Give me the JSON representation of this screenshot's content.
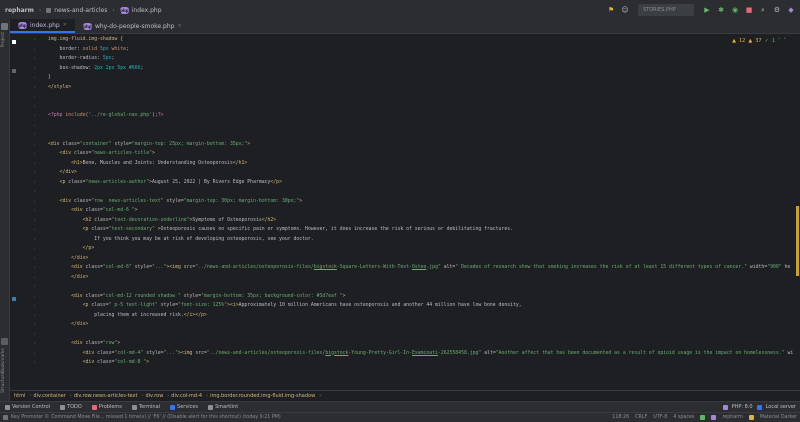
{
  "navbar": {
    "breadcrumbs": [
      "repharm",
      "news-and-articles",
      "index.php"
    ],
    "run_config": "STORIES.PHP",
    "icons": [
      "vcs-icon",
      "user-add-icon",
      "run-icon",
      "debug-icon",
      "coverage-icon",
      "stop-icon",
      "search-icon",
      "settings-icon",
      "ide-logo-icon"
    ]
  },
  "tabs": [
    {
      "label": "index.php",
      "active": true,
      "badge": "PHP"
    },
    {
      "label": "why-do-people-smoke.php",
      "active": false,
      "badge": "PHP"
    }
  ],
  "left_strip": {
    "top_label": "Project",
    "bottom_labels": [
      "Structure",
      "Bookmarks"
    ]
  },
  "editor_status": {
    "warnings": "12",
    "typos": "37",
    "ok": "1"
  },
  "code_lines": [
    {
      "n": "",
      "segs": [
        [
          "c-sel",
          "img.img-fluid.img-shadow "
        ],
        [
          "c-punc",
          "{"
        ]
      ]
    },
    {
      "n": "",
      "segs": [
        [
          "c-prop",
          "    border: "
        ],
        [
          "c-kw",
          "solid "
        ],
        [
          "c-num",
          "5px "
        ],
        [
          "c-kw",
          "white"
        ],
        [
          "c-punc",
          ";"
        ]
      ]
    },
    {
      "n": "",
      "segs": [
        [
          "c-prop",
          "    border-radius: "
        ],
        [
          "c-num",
          "5px"
        ],
        [
          "c-punc",
          ";"
        ]
      ]
    },
    {
      "n": "",
      "segs": [
        [
          "c-prop",
          "    box-shadow: "
        ],
        [
          "c-num",
          "2px 2px 5px #666"
        ],
        [
          "c-punc",
          ";"
        ]
      ]
    },
    {
      "n": "",
      "segs": [
        [
          "c-punc",
          "}"
        ]
      ]
    },
    {
      "n": "",
      "segs": [
        [
          "c-tag",
          "</style>"
        ]
      ]
    },
    {
      "n": "",
      "segs": []
    },
    {
      "n": "",
      "segs": []
    },
    {
      "n": "",
      "segs": [
        [
          "c-php",
          "<?php "
        ],
        [
          "c-kw",
          "include"
        ],
        [
          "c-punc",
          "("
        ],
        [
          "c-val",
          "'../re-global-nav.php'"
        ],
        [
          "c-punc",
          ");"
        ],
        [
          "c-php",
          "?>"
        ]
      ]
    },
    {
      "n": "",
      "segs": []
    },
    {
      "n": "",
      "segs": []
    },
    {
      "n": "",
      "segs": [
        [
          "c-tag",
          "<div "
        ],
        [
          "c-attr",
          "class="
        ],
        [
          "c-val",
          "\"container\" "
        ],
        [
          "c-attr",
          "style="
        ],
        [
          "c-val",
          "\"margin-top: 25px; margin-bottom: 35px;\""
        ],
        [
          "c-tag",
          ">"
        ]
      ]
    },
    {
      "n": "",
      "segs": [
        [
          "c-tag",
          "    <div "
        ],
        [
          "c-attr",
          "class="
        ],
        [
          "c-val",
          "\"news-articles-title\""
        ],
        [
          "c-tag",
          ">"
        ]
      ]
    },
    {
      "n": "",
      "segs": [
        [
          "c-tag",
          "        <h1>"
        ],
        [
          "c-text",
          "Bone, Muscles and Joints: Understanding Osteoporosis"
        ],
        [
          "c-tag",
          "</h1>"
        ]
      ]
    },
    {
      "n": "",
      "segs": [
        [
          "c-tag",
          "    </div>"
        ]
      ]
    },
    {
      "n": "",
      "segs": [
        [
          "c-tag",
          "    <p "
        ],
        [
          "c-attr",
          "class="
        ],
        [
          "c-val",
          "\"news-articles-author\""
        ],
        [
          "c-tag",
          ">"
        ],
        [
          "c-text",
          "August 25, 2022 | By Rivers Edge Pharmacy"
        ],
        [
          "c-tag",
          "</p>"
        ]
      ]
    },
    {
      "n": "",
      "segs": []
    },
    {
      "n": "",
      "segs": [
        [
          "c-tag",
          "    <div "
        ],
        [
          "c-attr",
          "class="
        ],
        [
          "c-val",
          "\"row  news-articles-text\" "
        ],
        [
          "c-attr",
          "style="
        ],
        [
          "c-val",
          "\"margin-top: 30px; margin-bottom: 30px;\""
        ],
        [
          "c-tag",
          ">"
        ]
      ]
    },
    {
      "n": "",
      "segs": [
        [
          "c-tag",
          "        <div "
        ],
        [
          "c-attr",
          "class="
        ],
        [
          "c-val",
          "\"col-md-6 \""
        ],
        [
          "c-tag",
          ">"
        ]
      ]
    },
    {
      "n": "",
      "segs": [
        [
          "c-tag",
          "            <h2 "
        ],
        [
          "c-attr",
          "class="
        ],
        [
          "c-val",
          "\"text-decoration-underline\""
        ],
        [
          "c-tag",
          ">"
        ],
        [
          "c-text",
          "Symptoms of Osteoporosis"
        ],
        [
          "c-tag",
          "</h2>"
        ]
      ]
    },
    {
      "n": "",
      "segs": [
        [
          "c-tag",
          "            <p "
        ],
        [
          "c-attr",
          "class="
        ],
        [
          "c-val",
          "\"text-secondary\" "
        ],
        [
          "c-tag",
          ">"
        ],
        [
          "c-text",
          "Osteoporosis causes no specific pain or symptoms. However, it does increase the risk of serious or debilitating fractures."
        ]
      ]
    },
    {
      "n": "",
      "segs": [
        [
          "c-text",
          "                If you think you may be at risk of developing osteoporosis, see your doctor."
        ]
      ]
    },
    {
      "n": "",
      "segs": [
        [
          "c-tag",
          "            </p>"
        ]
      ]
    },
    {
      "n": "",
      "segs": [
        [
          "c-tag",
          "        </div>"
        ]
      ]
    },
    {
      "n": "",
      "segs": [
        [
          "c-tag",
          "        <div "
        ],
        [
          "c-attr",
          "class="
        ],
        [
          "c-val",
          "\"col-md-6\" "
        ],
        [
          "c-attr",
          "style="
        ],
        [
          "c-val",
          "\"...\""
        ],
        [
          "c-tag",
          "><img "
        ],
        [
          "c-attr",
          "src="
        ],
        [
          "c-val",
          "\"../news-and-articles/osteoporosis-files/"
        ],
        [
          "c-link",
          "bigstock"
        ],
        [
          "c-val",
          "-Square-Letters-With-Text-"
        ],
        [
          "c-link",
          "Osteo"
        ],
        [
          "c-val",
          ".jpg\" "
        ],
        [
          "c-attr",
          "alt="
        ],
        [
          "c-val",
          "\" Decades of research show that smoking increases the risk of at least 15 different types of cancer.\" "
        ],
        [
          "c-attr",
          "width="
        ],
        [
          "c-val",
          "\"900\" "
        ],
        [
          "c-attr",
          "he"
        ]
      ]
    },
    {
      "n": "",
      "segs": [
        [
          "c-tag",
          "        </div>"
        ]
      ]
    },
    {
      "n": "",
      "segs": []
    },
    {
      "n": "",
      "segs": [
        [
          "c-tag",
          "        <div "
        ],
        [
          "c-attr",
          "class="
        ],
        [
          "c-val",
          "\"col-md-12 rounded shadow \" "
        ],
        [
          "c-attr",
          "style="
        ],
        [
          "c-val",
          "\"margin-bottom: 35px; background-color: #3d7eaf \""
        ],
        [
          "c-tag",
          ">"
        ]
      ]
    },
    {
      "n": "",
      "segs": [
        [
          "c-tag",
          "            <p "
        ],
        [
          "c-attr",
          "class="
        ],
        [
          "c-val",
          "\" p-5 text-light\" "
        ],
        [
          "c-attr",
          "style="
        ],
        [
          "c-val",
          "\"font-size: 125%\""
        ],
        [
          "c-tag",
          "><i>"
        ],
        [
          "c-text",
          "Approximately 10 million Americans have osteoporosis and another 44 million have low bone density,"
        ]
      ]
    },
    {
      "n": "",
      "segs": [
        [
          "c-text",
          "                placing them at increased risk."
        ],
        [
          "c-tag",
          "</i></p>"
        ]
      ]
    },
    {
      "n": "",
      "segs": [
        [
          "c-tag",
          "        </div>"
        ]
      ]
    },
    {
      "n": "",
      "segs": []
    },
    {
      "n": "",
      "segs": [
        [
          "c-tag",
          "        <div "
        ],
        [
          "c-attr",
          "class="
        ],
        [
          "c-val",
          "\"row\""
        ],
        [
          "c-tag",
          ">"
        ]
      ]
    },
    {
      "n": "",
      "segs": [
        [
          "c-tag",
          "            <div "
        ],
        [
          "c-attr",
          "class="
        ],
        [
          "c-val",
          "\"col-md-4\" "
        ],
        [
          "c-attr",
          "style="
        ],
        [
          "c-val",
          "\"...\""
        ],
        [
          "c-tag",
          "><img "
        ],
        [
          "c-attr",
          "src="
        ],
        [
          "c-val",
          "\"../news-and-articles/osteoporosis-files/"
        ],
        [
          "c-link",
          "bigstock"
        ],
        [
          "c-val",
          "-Young-Pretty-Girl-In-"
        ],
        [
          "c-link",
          "Examinati"
        ],
        [
          "c-val",
          "-262558458.jpg\" "
        ],
        [
          "c-attr",
          "alt="
        ],
        [
          "c-val",
          "\"Another affect that has been documented as a result of opioid usage is the impact on homelessness.\" "
        ],
        [
          "c-attr",
          "wi"
        ]
      ]
    },
    {
      "n": "",
      "segs": [
        [
          "c-tag",
          "            <div "
        ],
        [
          "c-attr",
          "class="
        ],
        [
          "c-val",
          "\"col-md-8 \""
        ],
        [
          "c-tag",
          ">"
        ]
      ]
    }
  ],
  "editor_breadcrumb": [
    "html",
    "div.container",
    "div.row.news-articles-text",
    "div.row",
    "div.col-md-4",
    "img.border.rounded.img-fluid.img-shadow"
  ],
  "tool_windows": [
    {
      "label": "Version Control",
      "icon": "branch-icon",
      "color": "#8c8f94"
    },
    {
      "label": "TODO",
      "icon": "todo-icon",
      "color": "#8c8f94"
    },
    {
      "label": "Problems",
      "icon": "problems-icon",
      "color": "#e06c75"
    },
    {
      "label": "Terminal",
      "icon": "terminal-icon",
      "color": "#8c8f94"
    },
    {
      "label": "Services",
      "icon": "services-icon",
      "color": "#3574f0"
    },
    {
      "label": "Smartlint",
      "icon": "smartlint-icon",
      "color": "#8c8f94"
    }
  ],
  "tool_windows_right": {
    "language": "PHP: 8.0",
    "server": "Local server",
    "project": "repharm",
    "theme": "Material Darker"
  },
  "status": {
    "message": "Key Promoter X: Command Move File... missed 1 time(s) // 'F6' // (Disable alert for this shortcut) (today 9:21 PM)",
    "position": "118:26",
    "line_ending": "CRLF",
    "encoding": "UTF-8",
    "indent": "4 spaces"
  },
  "colors": {
    "accent": "#3574f0",
    "warning": "#e2b33b",
    "php_badge": "#a587d9"
  }
}
